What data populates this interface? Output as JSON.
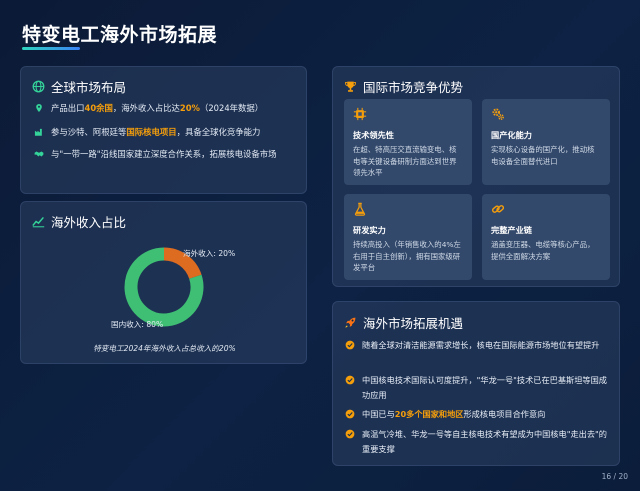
{
  "title": "特变电工海外市场拓展",
  "global_layout": {
    "title": "全球市场布局",
    "items": [
      {
        "icon": "location-pin-icon",
        "parts": [
          {
            "text": "产品出口",
            "hl": false
          },
          {
            "text": "40余国",
            "hl": true
          },
          {
            "text": "，海外收入占比达",
            "hl": false
          },
          {
            "text": "20%",
            "hl": true
          },
          {
            "text": "（2024年数据）",
            "hl": false
          }
        ]
      },
      {
        "icon": "factory-icon",
        "parts": [
          {
            "text": "参与沙特、阿根廷等",
            "hl": false
          },
          {
            "text": "国际核电项目",
            "hl": true
          },
          {
            "text": "，具备全球化竞争能力",
            "hl": false
          }
        ]
      },
      {
        "icon": "handshake-icon",
        "parts": [
          {
            "text": "与\"一带一路\"沿线国家建立深度合作关系，拓展核电设备市场",
            "hl": false
          }
        ]
      }
    ]
  },
  "revenue_share": {
    "title": "海外收入占比",
    "caption": "特变电工2024年海外收入占总收入的20%",
    "chart_data": {
      "type": "pie",
      "categories": [
        "海外收入",
        "国内收入"
      ],
      "values": [
        20,
        80
      ],
      "labels": [
        "海外收入: 20%",
        "国内收入: 80%"
      ],
      "colors": [
        "#dd6b20",
        "#3fbf73"
      ]
    }
  },
  "advantages": {
    "title": "国际市场竞争优势",
    "items": [
      {
        "icon": "chip-icon",
        "title": "技术领先性",
        "desc": "在超、特高压交直流输变电、核电等关键设备研制方面达到世界领先水平"
      },
      {
        "icon": "gears-icon",
        "title": "国产化能力",
        "desc": "实现核心设备的国产化，推动核电设备全面替代进口"
      },
      {
        "icon": "flask-icon",
        "title": "研发实力",
        "desc": "持续高投入（年销售收入的4%左右用于自主创新），拥有国家级研发平台"
      },
      {
        "icon": "link-icon",
        "title": "完整产业链",
        "desc": "涵盖变压器、电缆等核心产品，提供全面解决方案"
      }
    ]
  },
  "opportunities": {
    "title": "海外市场拓展机遇",
    "items": [
      {
        "parts": [
          {
            "text": "随着全球对清洁能源需求增长，核电在国际能源市场地位有望提升",
            "hl": false
          }
        ]
      },
      {
        "parts": [
          {
            "text": "中国核电技术国际认可度提升，\"华龙一号\"技术已在巴基斯坦等国成功应用",
            "hl": false
          }
        ]
      },
      {
        "parts": [
          {
            "text": "中国已与",
            "hl": false
          },
          {
            "text": "20多个国家和地区",
            "hl": true
          },
          {
            "text": "形成核电项目合作意向",
            "hl": false
          }
        ]
      },
      {
        "parts": [
          {
            "text": "高温气冷堆、华龙一号等自主核电技术有望成为中国核电\"走出去\"的重要支撑",
            "hl": false
          }
        ]
      }
    ]
  },
  "page_number": "16 / 20",
  "colors": {
    "accent_green": "#2dd4bf",
    "highlight": "#f59e0b",
    "domestic": "#3fbf73",
    "overseas": "#dd6b20"
  }
}
